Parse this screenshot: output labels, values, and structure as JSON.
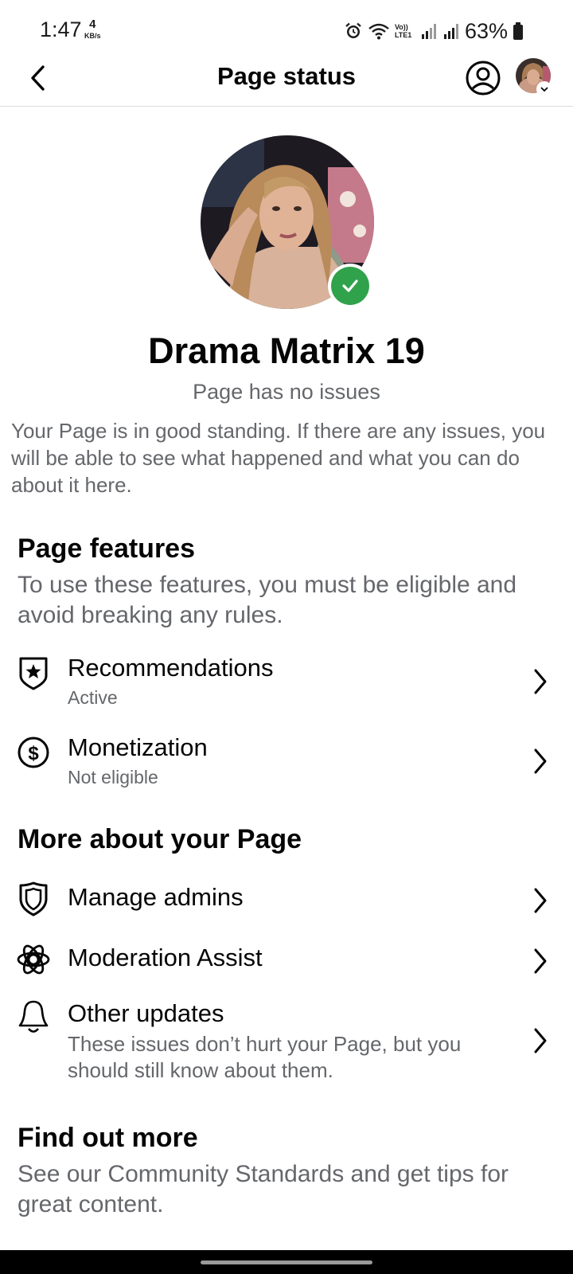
{
  "status_bar": {
    "time": "1:47",
    "speed_value": "4",
    "speed_unit": "KB/s",
    "network_label": "Vo)) LTE1",
    "battery": "63%"
  },
  "header": {
    "title": "Page status",
    "back_icon": "chevron-left-icon",
    "profile_icon": "person-circle-icon"
  },
  "profile": {
    "name": "Drama Matrix 19",
    "status": "Page has no issues",
    "description": "Your Page is in good standing. If there are any issues, you will be able to see what happened and what you can do about it here.",
    "status_color": "#31a24c"
  },
  "page_features": {
    "title": "Page features",
    "subtitle": "To use these features, you must be eligible and avoid breaking any rules.",
    "items": [
      {
        "label": "Recommendations",
        "status": "Active",
        "icon": "shield-star-icon"
      },
      {
        "label": "Monetization",
        "status": "Not eligible",
        "icon": "dollar-circle-icon"
      }
    ]
  },
  "more_about": {
    "title": "More about your Page",
    "items": [
      {
        "label": "Manage admins",
        "icon": "shield-icon"
      },
      {
        "label": "Moderation Assist",
        "icon": "gear-atom-icon"
      },
      {
        "label": "Other updates",
        "description": "These issues don’t hurt your Page, but you should still know about them.",
        "icon": "bell-icon"
      }
    ]
  },
  "find_out_more": {
    "title": "Find out more",
    "subtitle": "See our Community Standards and get tips for great content."
  },
  "colors": {
    "text_primary": "#050505",
    "text_secondary": "#65676b",
    "verified": "#31a24c",
    "divider": "#dadde1"
  }
}
